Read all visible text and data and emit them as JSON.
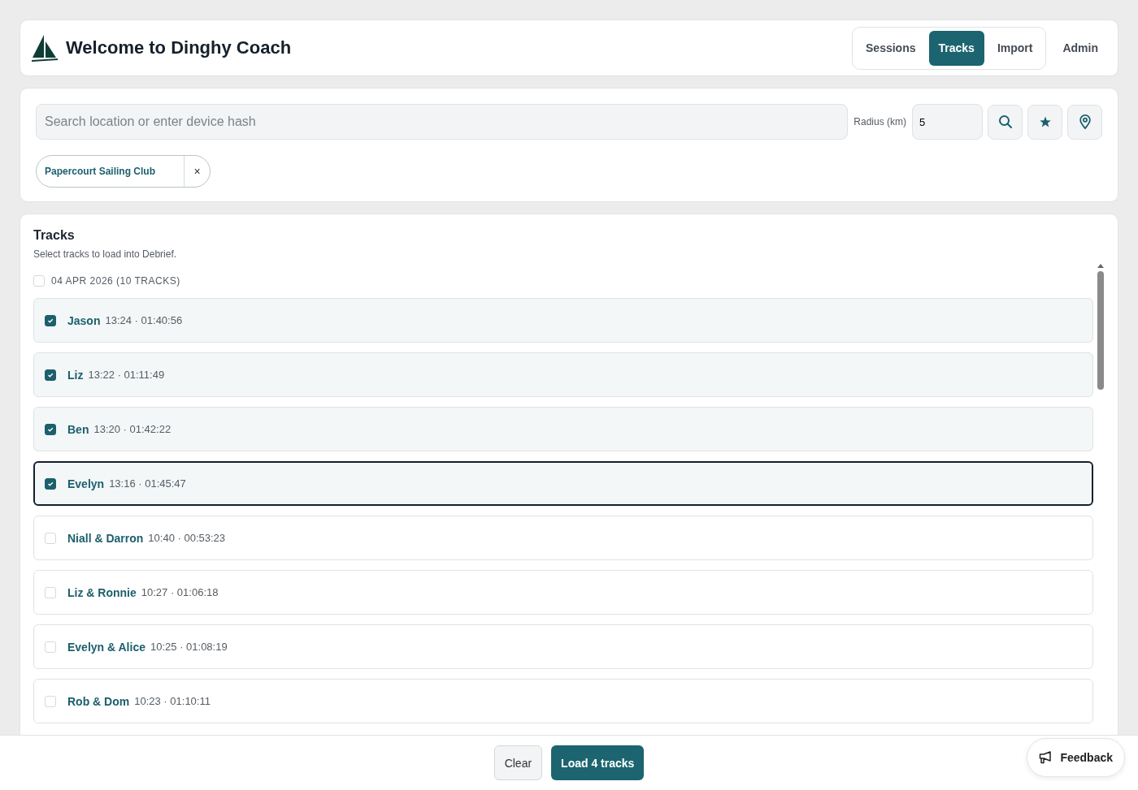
{
  "header": {
    "title": "Welcome to Dinghy Coach",
    "nav": [
      {
        "label": "Sessions",
        "selected": false
      },
      {
        "label": "Tracks",
        "selected": true
      },
      {
        "label": "Import",
        "selected": false
      }
    ],
    "admin": "Admin"
  },
  "search": {
    "placeholder": "Search location or enter device hash",
    "radius_label": "Radius (km)",
    "radius": "5",
    "chips": [
      {
        "label": "Papercourt Sailing Club",
        "remove": "×"
      }
    ]
  },
  "tracks": {
    "title": "Tracks",
    "subtitle": "Select tracks to load into Debrief.",
    "group": {
      "label": "04 APR 2026 (10 TRACKS)",
      "checked": false
    },
    "items": [
      {
        "name": "Jason",
        "meta": "13:24 · 01:40:56",
        "checked": true,
        "focused": false
      },
      {
        "name": "Liz",
        "meta": "13:22 · 01:11:49",
        "checked": true,
        "focused": false
      },
      {
        "name": "Ben",
        "meta": "13:20 · 01:42:22",
        "checked": true,
        "focused": false
      },
      {
        "name": "Evelyn",
        "meta": "13:16 · 01:45:47",
        "checked": true,
        "focused": true
      },
      {
        "name": "Niall & Darron",
        "meta": "10:40 · 00:53:23",
        "checked": false,
        "focused": false
      },
      {
        "name": "Liz & Ronnie",
        "meta": "10:27 · 01:06:18",
        "checked": false,
        "focused": false
      },
      {
        "name": "Evelyn & Alice",
        "meta": "10:25 · 01:08:19",
        "checked": false,
        "focused": false
      },
      {
        "name": "Rob & Dom",
        "meta": "10:23 · 01:10:11",
        "checked": false,
        "focused": false
      }
    ]
  },
  "footer": {
    "clear": "Clear",
    "load": "Load 4 tracks",
    "feedback": "Feedback"
  }
}
